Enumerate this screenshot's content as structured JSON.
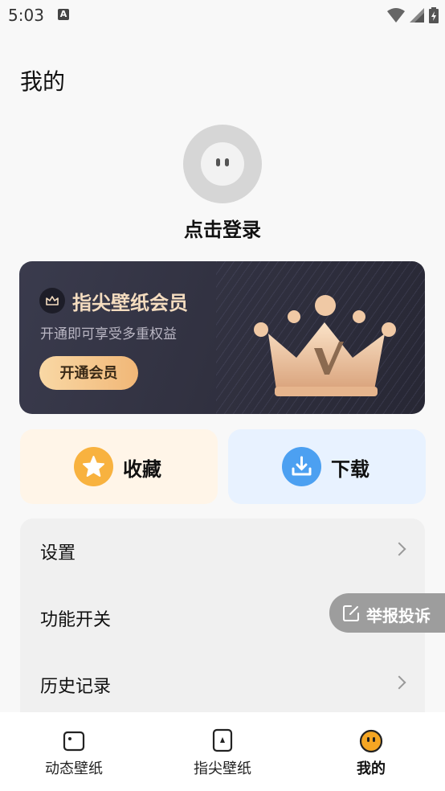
{
  "status_bar": {
    "time": "5:03",
    "notification_icon": "A"
  },
  "page": {
    "title": "我的"
  },
  "profile": {
    "login_text": "点击登录"
  },
  "vip": {
    "title": "指尖壁纸会员",
    "subtitle": "开通即可享受多重权益",
    "button_label": "开通会员"
  },
  "quick_actions": [
    {
      "label": "收藏",
      "icon": "star-icon",
      "color": "#f8b23f"
    },
    {
      "label": "下载",
      "icon": "download-icon",
      "color": "#4ca0f1"
    }
  ],
  "menu": [
    {
      "label": "设置"
    },
    {
      "label": "功能开关"
    },
    {
      "label": "历史记录"
    }
  ],
  "report_button": {
    "label": "举报投诉"
  },
  "tabs": [
    {
      "label": "动态壁纸",
      "icon": "dynamic-wallpaper-icon",
      "active": false
    },
    {
      "label": "指尖壁纸",
      "icon": "fingertip-wallpaper-icon",
      "active": false
    },
    {
      "label": "我的",
      "icon": "my-face-icon",
      "active": true
    }
  ],
  "colors": {
    "accent_gold": "#f1b777",
    "active_tab": "#f5a623"
  }
}
